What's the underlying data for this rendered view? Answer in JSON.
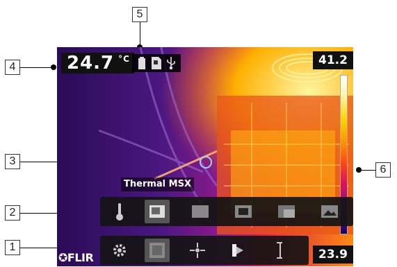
{
  "callouts": {
    "c1": "1",
    "c2": "2",
    "c3": "3",
    "c4": "4",
    "c5": "5",
    "c6": "6"
  },
  "readout": {
    "value": "24.7",
    "unit": "°C"
  },
  "scale": {
    "max": "41.2",
    "min": "23.9"
  },
  "mode_label": "Thermal MSX",
  "brand": "FLIR",
  "status_icons": [
    "battery-icon",
    "sd-card-icon",
    "usb-icon"
  ],
  "toolbar_upper": [
    "thermometer-icon",
    "thermal-mode-icon",
    "thermal-only-icon",
    "picture-in-picture-icon",
    "fusion-icon",
    "visual-camera-icon"
  ],
  "toolbar_lower": [
    "settings-gear-icon",
    "image-mode-icon",
    "measurement-icon",
    "color-palette-icon",
    "temperature-scale-icon"
  ],
  "colors": {
    "palette_hot": "#ffe45a",
    "palette_cold": "#2a0b55"
  }
}
